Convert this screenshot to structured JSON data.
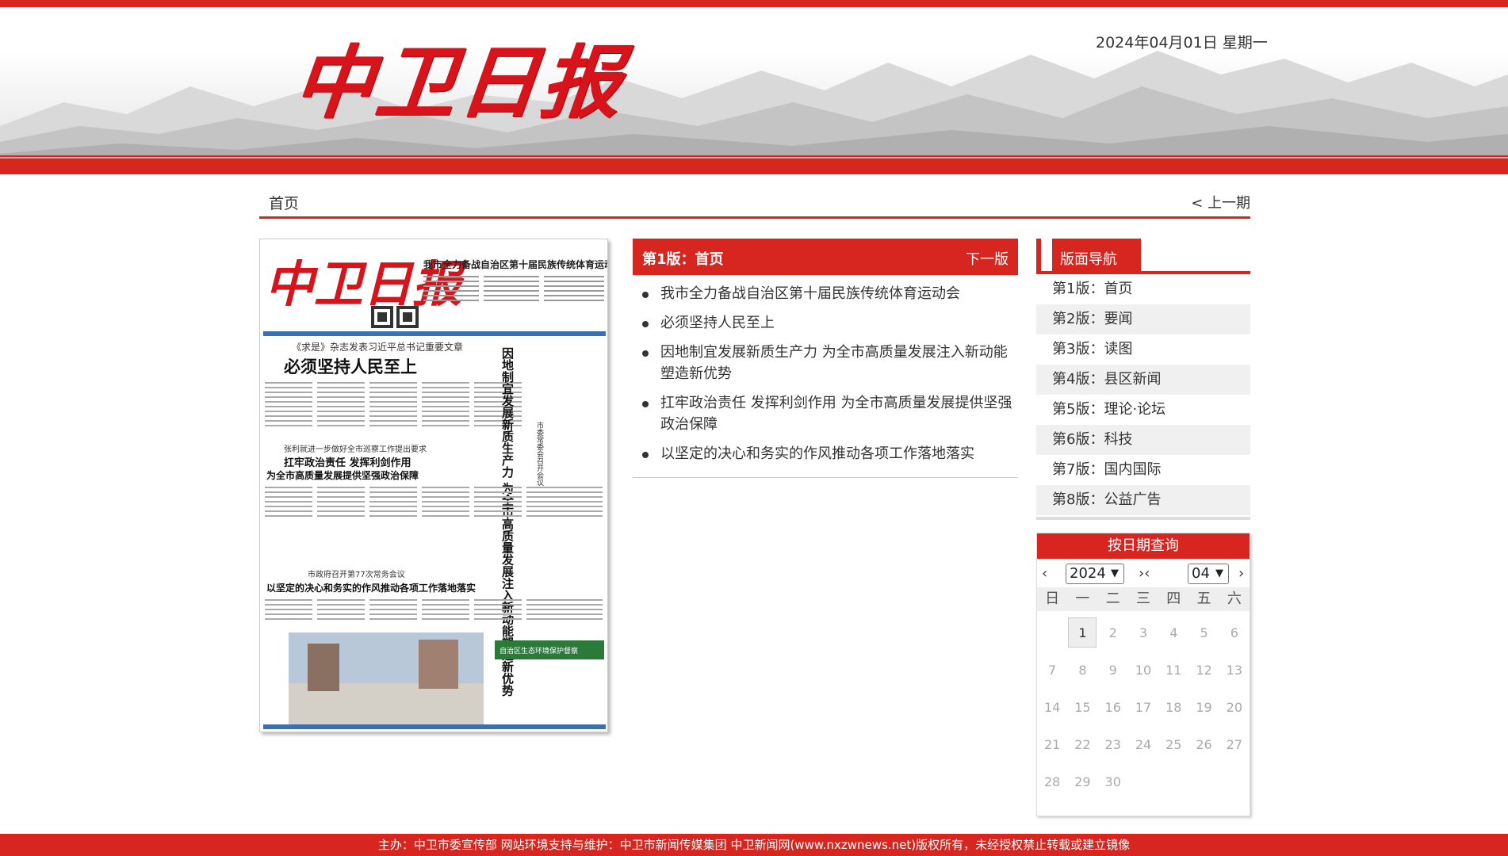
{
  "header": {
    "logo": "中卫日报",
    "date": "2024年04月01日  星期一"
  },
  "nav": {
    "home": "首页",
    "prev_issue": "< 上一期"
  },
  "newspaper": {
    "masthead": "中卫日报",
    "top_headline": "我市全力备战自治区第十届民族传统体育运动会",
    "sub_headline": "《求是》杂志发表习近平总书记重要文章",
    "main_headline": "必须坚持人民至上",
    "vertical_headline": "因地制宜发展新质生产力 为全市高质量发展注入新动能塑造新优势",
    "vertical_sub": "市委常委会召开会议",
    "kicker2": "张利就进一步做好全市巡察工作提出要求",
    "headline2": "扛牢政治责任 发挥利剑作用",
    "headline2b": "为全市高质量发展提供坚强政治保障",
    "kicker3": "市政府召开第77次常务会议",
    "headline3": "以坚定的决心和务实的作风推动各项工作落地落实",
    "box_title": "自治区生态环境保护督察"
  },
  "middle": {
    "title": "第1版：首页",
    "next": "下一版",
    "articles": [
      "我市全力备战自治区第十届民族传统体育运动会",
      "必须坚持人民至上",
      "因地制宜发展新质生产力 为全市高质量发展注入新动能塑造新优势",
      "扛牢政治责任 发挥利剑作用 为全市高质量发展提供坚强政治保障",
      "以坚定的决心和务实的作风推动各项工作落地落实"
    ]
  },
  "page_nav": {
    "title": "版面导航",
    "pages": [
      "第1版：首页",
      "第2版：要闻",
      "第3版：读图",
      "第4版：县区新闻",
      "第5版：理论·论坛",
      "第6版：科技",
      "第7版：国内国际",
      "第8版：公益广告"
    ]
  },
  "calendar": {
    "title": "按日期查询",
    "prev_year": "‹",
    "year": "2024",
    "mid_arrows": "›‹",
    "month": "04",
    "next_month": "›",
    "weekdays": [
      "日",
      "一",
      "二",
      "三",
      "四",
      "五",
      "六"
    ],
    "days": [
      "",
      "1",
      "2",
      "3",
      "4",
      "5",
      "6",
      "7",
      "8",
      "9",
      "10",
      "11",
      "12",
      "13",
      "14",
      "15",
      "16",
      "17",
      "18",
      "19",
      "20",
      "21",
      "22",
      "23",
      "24",
      "25",
      "26",
      "27",
      "28",
      "29",
      "30"
    ],
    "active_day": "1"
  },
  "footer": {
    "text": "主办：中卫市委宣传部 网站环境支持与维护：中卫市新闻传媒集团 中卫新闻网(www.nxzwnews.net)版权所有，未经授权禁止转载或建立镜像"
  },
  "colors": {
    "brand_red": "#d7251f"
  }
}
